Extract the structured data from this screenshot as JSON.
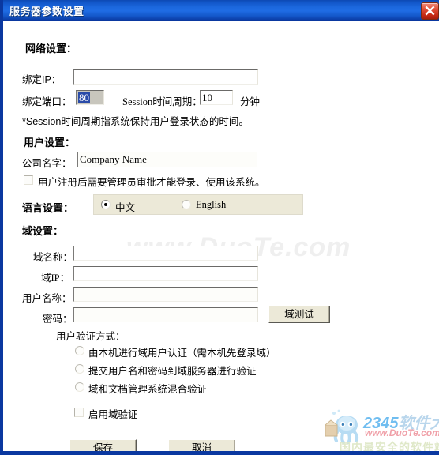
{
  "window": {
    "title": "服务器参数设置",
    "close_icon": "close-icon",
    "accent": "#1f6ce4",
    "border_color": "#0a38a0"
  },
  "network": {
    "section_title": "网络设置：",
    "bind_ip_label": "绑定IP：",
    "bind_ip_value": "",
    "bind_port_label": "绑定端口：",
    "bind_port_value": "80",
    "session_label": "Session时间周期：",
    "session_value": "10",
    "session_unit": "分钟",
    "note": "*Session时间周期指系统保持用户登录状态的时间。"
  },
  "user": {
    "section_title": "用户设置：",
    "company_label": "公司名字：",
    "company_value": "Company Name",
    "approve_checkbox_label": "用户注册后需要管理员审批才能登录、使用该系统。",
    "approve_checked": false
  },
  "language": {
    "section_title": "语言设置：",
    "options": [
      {
        "label": "中文",
        "selected": true
      },
      {
        "label": "English",
        "selected": false
      }
    ]
  },
  "domain": {
    "section_title": "域设置：",
    "name_label": "域名称：",
    "name_value": "",
    "ip_label": "域IP：",
    "ip_value": "",
    "user_label": "用户名称：",
    "user_value": "",
    "password_label": "密码：",
    "password_value": "",
    "test_button": "域测试",
    "auth_title": "用户验证方式：",
    "auth_options": [
      {
        "label": "由本机进行域用户认证（需本机先登录域）",
        "selected": false
      },
      {
        "label": "提交用户名和密码到域服务器进行验证",
        "selected": false
      },
      {
        "label": "域和文档管理系统混合验证",
        "selected": false
      }
    ],
    "enable_checkbox_label": "启用域验证",
    "enable_checked": false
  },
  "footer": {
    "save_label": "保存",
    "cancel_label": "取消"
  },
  "watermark": {
    "site": "www.DuoTe.com",
    "logo_2345": "2345",
    "logo_soft": "软件大全",
    "logo_url": "www.DuoTe.com",
    "logo_slogan": "国内最安全的软件站"
  }
}
